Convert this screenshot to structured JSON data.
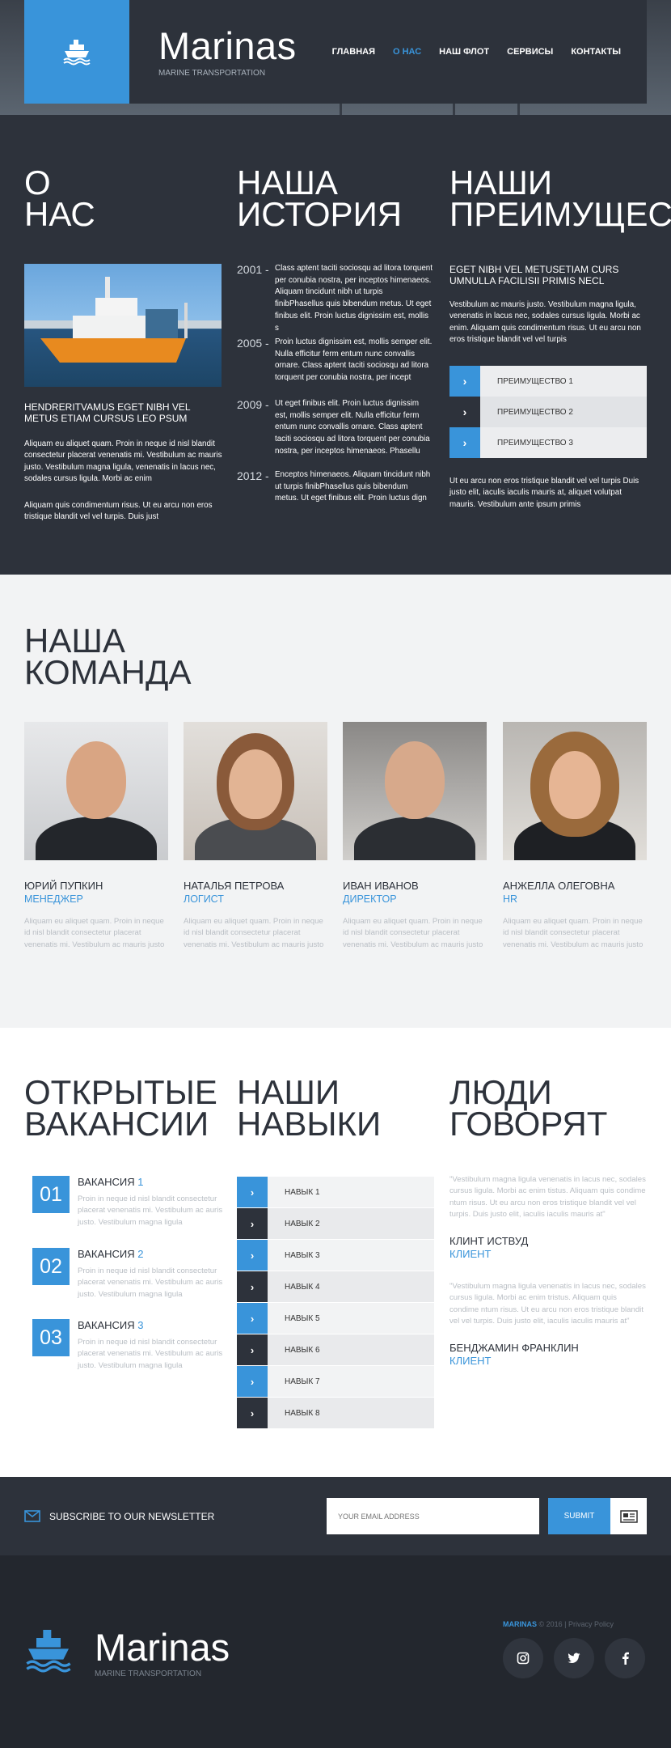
{
  "header": {
    "brand_name": "Marinas",
    "brand_tagline": "MARINE TRANSPORTATION",
    "nav": [
      "ГЛАВНАЯ",
      "О НАС",
      "НАШ ФЛОТ",
      "СЕРВИСЫ",
      "КОНТАКТЫ"
    ],
    "active_nav": "О НАС"
  },
  "about": {
    "title_l1": "О",
    "title_l2": "НАС",
    "subtitle_l1": "HENDRERITVAMUS EGET NIBH VEL",
    "subtitle_l2": "METUS ETIAM CURSUS LEO PSUM",
    "p1": "Aliquam eu aliquet quam. Proin in neque id nisl blandit consectetur placerat venenatis mi. Vestibulum ac mauris justo. Vestibulum magna ligula, venenatis in lacus nec, sodales cursus ligula. Morbi ac enim",
    "p2": "Aliquam quis condimentum risus. Ut eu arcu non eros tristique blandit vel vel turpis. Duis just"
  },
  "history": {
    "title_l1": "НАША",
    "title_l2": "ИСТОРИЯ",
    "items": [
      {
        "year": "2001 -",
        "text": "Class aptent taciti sociosqu ad litora torquent per conubia nostra, per inceptos himenaeos. Aliquam tincidunt nibh ut turpis finibPhasellus quis bibendum metus. Ut eget finibus elit. Proin luctus dignissim est, mollis s"
      },
      {
        "year": "2005 -",
        "text": "Proin luctus dignissim est, mollis semper elit. Nulla efficitur ferm entum nunc convallis ornare. Class aptent taciti sociosqu ad litora torquent per conubia nostra, per incept"
      },
      {
        "year": "2009 -",
        "text": "Ut eget finibus elit. Proin luctus dignissim est, mollis semper elit. Nulla efficitur ferm entum nunc convallis ornare. Class aptent taciti sociosqu ad litora torquent per conubia nostra, per inceptos himenaeos. Phasellu"
      },
      {
        "year": "2012 -",
        "text": "Enceptos himenaeos. Aliquam tincidunt nibh ut turpis finibPhasellus quis bibendum metus. Ut eget finibus elit. Proin luctus dign"
      }
    ]
  },
  "advantages": {
    "title_l1": "НАШИ",
    "title_l2": "ПРЕИМУЩЕСТВА",
    "subtitle_l1": "EGET NIBH VEL METUSETIAM CURS",
    "subtitle_l2": "UMNULLA FACILISII PRIMIS NECL",
    "p1": "Vestibulum ac mauris justo. Vestibulum magna ligula, venenatis in lacus nec, sodales cursus ligula. Morbi ac enim. Aliquam quis condimentum risus. Ut eu arcu non eros tristique blandit vel vel turpis",
    "items": [
      "ПРЕИМУЩЕСТВО 1",
      "ПРЕИМУЩЕСТВО 2",
      "ПРЕИМУЩЕСТВО 3"
    ],
    "p2": "Ut eu arcu non eros tristique blandit vel vel turpis Duis justo elit, iaculis iaculis mauris at, aliquet volutpat mauris. Vestibulum ante ipsum primis"
  },
  "team": {
    "title_l1": "НАША",
    "title_l2": "КОМАНДА",
    "members": [
      {
        "name": "ЮРИЙ ПУПКИН",
        "role": "МЕНЕДЖЕР",
        "desc": "Aliquam eu aliquet quam. Proin in neque id nisl blandit consectetur placerat venenatis mi. Vestibulum ac mauris justo"
      },
      {
        "name": "НАТАЛЬЯ ПЕТРОВА",
        "role": "ЛОГИСТ",
        "desc": "Aliquam eu aliquet quam. Proin in neque id nisl blandit consectetur placerat venenatis mi. Vestibulum ac mauris justo"
      },
      {
        "name": "ИВАН ИВАНОВ",
        "role": "ДИРЕКТОР",
        "desc": "Aliquam eu aliquet quam. Proin in neque id nisl blandit consectetur placerat venenatis mi. Vestibulum ac mauris justo"
      },
      {
        "name": "АНЖЕЛЛА ОЛЕГОВНА",
        "role": "HR",
        "desc": "Aliquam eu aliquet quam. Proin in neque id nisl blandit consectetur placerat venenatis mi. Vestibulum ac mauris justo"
      }
    ]
  },
  "vacancies": {
    "title_l1": "ОТКРЫТЫЕ",
    "title_l2": "ВАКАНСИИ",
    "items": [
      {
        "num": "01",
        "label": "ВАКАНСИЯ",
        "n": "1",
        "desc": "Proin in neque id nisl blandit consectetur placerat venenatis mi. Vestibulum ac auris justo. Vestibulum magna ligula"
      },
      {
        "num": "02",
        "label": "ВАКАНСИЯ",
        "n": "2",
        "desc": "Proin in neque id nisl blandit consectetur placerat venenatis mi. Vestibulum ac auris justo. Vestibulum magna ligula"
      },
      {
        "num": "03",
        "label": "ВАКАНСИЯ",
        "n": "3",
        "desc": "Proin in neque id nisl blandit consectetur placerat venenatis mi. Vestibulum ac auris justo. Vestibulum magna ligula"
      }
    ]
  },
  "skills": {
    "title_l1": "НАШИ",
    "title_l2": "НАВЫКИ",
    "items": [
      "НАВЫК 1",
      "НАВЫК 2",
      "НАВЫК 3",
      "НАВЫК 4",
      "НАВЫК 5",
      "НАВЫК 6",
      "НАВЫК 7",
      "НАВЫК 8"
    ]
  },
  "testimonials": {
    "title_l1": "ЛЮДИ",
    "title_l2": "ГОВОРЯТ",
    "items": [
      {
        "quote": "\"Vestibulum magna ligula venenatis in lacus nec, sodales cursus ligula. Morbi ac enim tistus. Aliquam quis condime ntum risus. Ut eu arcu non eros tristique blandit vel vel turpis. Duis justo elit, iaculis iaculis mauris at\"",
        "name": "КЛИНТ ИСТВУД",
        "role": "КЛИЕНТ"
      },
      {
        "quote": "\"Vestibulum magna ligula venenatis in lacus nec, sodales cursus ligula. Morbi ac enim tristus. Aliquam quis condime ntum risus. Ut eu arcu non eros tristique blandit vel vel turpis. Duis justo elit, iaculis iaculis mauris at\"",
        "name": "БЕНДЖАМИН ФРАНКЛИН",
        "role": "КЛИЕНТ"
      }
    ]
  },
  "newsletter": {
    "label": "SUBSCRIBE TO OUR NEWSLETTER",
    "placeholder": "YOUR EMAIL ADDRESS",
    "button": "SUBMIT"
  },
  "footer": {
    "brand_name": "Marinas",
    "brand_tagline": "MARINE TRANSPORTATION",
    "copy_brand": "MARINAS",
    "copy_text": "© 2016 |",
    "privacy": "Privacy Policy",
    "socials": [
      "instagram-icon",
      "twitter-icon",
      "facebook-icon"
    ]
  },
  "colors": {
    "accent": "#3994da",
    "dark": "#2d323b",
    "darker": "#23272e",
    "light": "#f2f3f4"
  }
}
